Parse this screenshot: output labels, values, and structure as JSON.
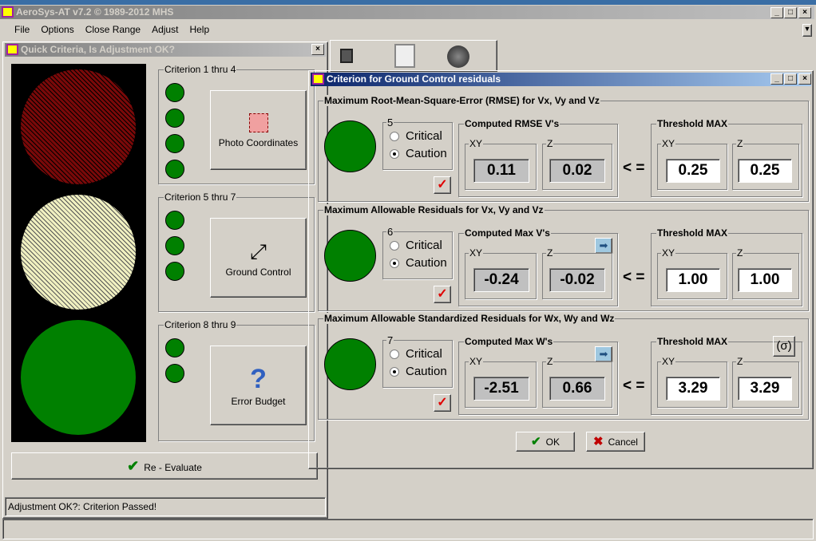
{
  "app": {
    "title": "AeroSys-AT  v7.2 © 1989-2012 MHS",
    "menu": [
      "File",
      "Options",
      "Close Range",
      "Adjust",
      "Help"
    ]
  },
  "quick": {
    "title": "Quick Criteria,  Is Adjustment OK?",
    "groups": [
      {
        "label": "Criterion 1 thru 4",
        "button": "Photo Coordinates",
        "dots": 4,
        "icon": "photo-coordinates-icon"
      },
      {
        "label": "Criterion 5 thru 7",
        "button": "Ground Control",
        "dots": 3,
        "icon": "ground-control-icon"
      },
      {
        "label": "Criterion 8 thru 9",
        "button": "Error Budget",
        "dots": 2,
        "icon": "question-icon"
      }
    ],
    "lights": [
      {
        "state": "red",
        "color": "#b03030"
      },
      {
        "state": "yellow",
        "color": "#f0f0c0"
      },
      {
        "state": "green",
        "color": "#008000"
      }
    ],
    "reevaluate": "Re - Evaluate",
    "status": "Adjustment OK?: Criterion Passed!"
  },
  "dialog": {
    "title": "Criterion for Ground Control residuals",
    "sections": [
      {
        "title": "Maximum Root-Mean-Square-Error (RMSE) for  Vx, Vy and Vz",
        "num": "5",
        "critical": "Critical",
        "caution": "Caution",
        "selected": "Caution",
        "computed_title": "Computed RMSE  V's",
        "xy_label": "XY",
        "z_label": "Z",
        "xy": "0.11",
        "z": "0.02",
        "op": "< =",
        "thresh_title": "Threshold MAX",
        "t_xy": "0.25",
        "t_z": "0.25"
      },
      {
        "title": "Maximum Allowable Residuals for  Vx, Vy and Vz",
        "num": "6",
        "critical": "Critical",
        "caution": "Caution",
        "selected": "Caution",
        "computed_title": "Computed Max V's",
        "xy_label": "XY",
        "z_label": "Z",
        "xy": "-0.24",
        "z": "-0.02",
        "op": "< =",
        "thresh_title": "Threshold MAX",
        "t_xy": "1.00",
        "t_z": "1.00"
      },
      {
        "title": "Maximum Allowable Standardized Residuals for Wx, Wy and Wz",
        "num": "7",
        "critical": "Critical",
        "caution": "Caution",
        "selected": "Caution",
        "computed_title": "Computed Max W's",
        "xy_label": "XY",
        "z_label": "Z",
        "xy": "-2.51",
        "z": "0.66",
        "op": "< =",
        "thresh_title": "Threshold MAX",
        "t_xy": "3.29",
        "t_z": "3.29",
        "sigma": "(σ)"
      }
    ],
    "ok": "OK",
    "cancel": "Cancel"
  }
}
